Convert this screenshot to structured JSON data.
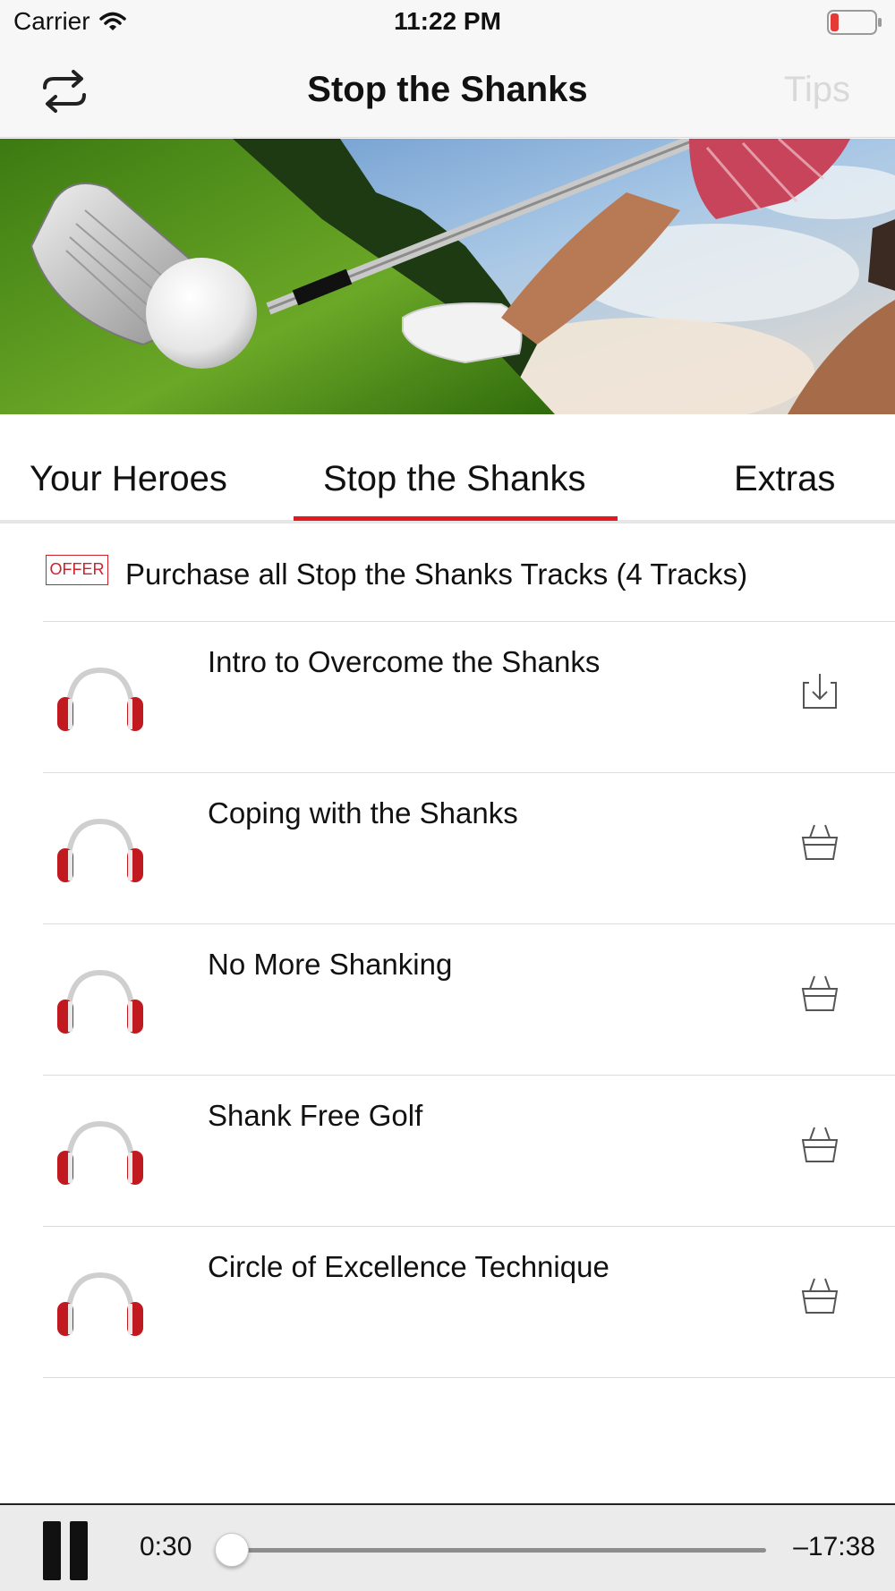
{
  "status_bar": {
    "carrier": "Carrier",
    "time": "11:22 PM",
    "battery_color": "#e53935"
  },
  "nav": {
    "title": "Stop the Shanks",
    "tips_label": "Tips",
    "back_icon": "repeat-arrows-icon"
  },
  "hero": {
    "icon": "golf-photo"
  },
  "tabs": [
    {
      "label": "Your Heroes",
      "selected": false
    },
    {
      "label": "Stop the Shanks",
      "selected": true
    },
    {
      "label": "Extras",
      "selected": false
    }
  ],
  "offer": {
    "badge": "OFFER",
    "text": "Purchase all Stop the Shanks Tracks (4 Tracks)"
  },
  "tracks": [
    {
      "title": "Intro to Overcome the Shanks",
      "action_icon": "download-icon"
    },
    {
      "title": "Coping with the Shanks",
      "action_icon": "basket-icon"
    },
    {
      "title": "No More Shanking",
      "action_icon": "basket-icon"
    },
    {
      "title": "Shank Free Golf",
      "action_icon": "basket-icon"
    },
    {
      "title": "Circle of Excellence Technique",
      "action_icon": "basket-icon"
    }
  ],
  "player": {
    "elapsed": "0:30",
    "remaining": "–17:38",
    "progress": 0.028
  },
  "colors": {
    "accent": "#e01a1f",
    "headphone_red": "#c0191f",
    "tips_disabled": "#d9d9d9"
  }
}
